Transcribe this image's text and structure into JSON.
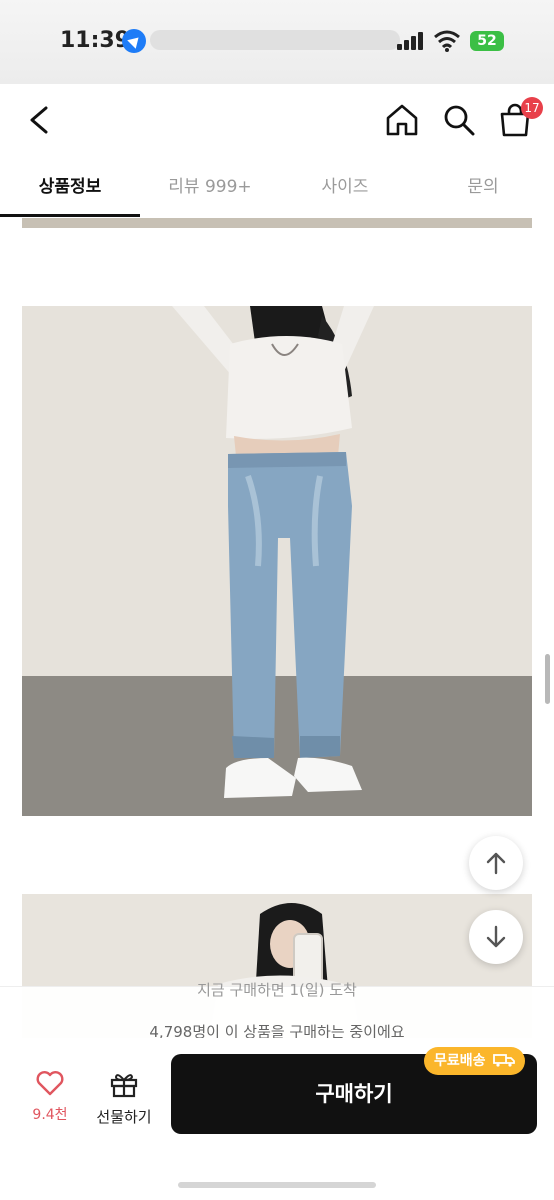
{
  "status_bar": {
    "time": "11:39",
    "battery": "52"
  },
  "header": {
    "cart_badge": "17"
  },
  "tabs": [
    {
      "label": "상품정보"
    },
    {
      "label": "리뷰 999+"
    },
    {
      "label": "사이즈"
    },
    {
      "label": "문의"
    }
  ],
  "sheet": {
    "partial_text": "지금 구매하면 1(일) 도착",
    "buyers_text": "4,798명이 이 상품을 구매하는 중이에요"
  },
  "bottom_bar": {
    "like_count": "9.4천",
    "gift_label": "선물하기",
    "buy_label": "구매하기",
    "shipping_badge": "무료배송"
  },
  "colors": {
    "accent_red": "#e8404a",
    "shipping_badge": "#fbb62b",
    "buy_button": "#111111"
  }
}
